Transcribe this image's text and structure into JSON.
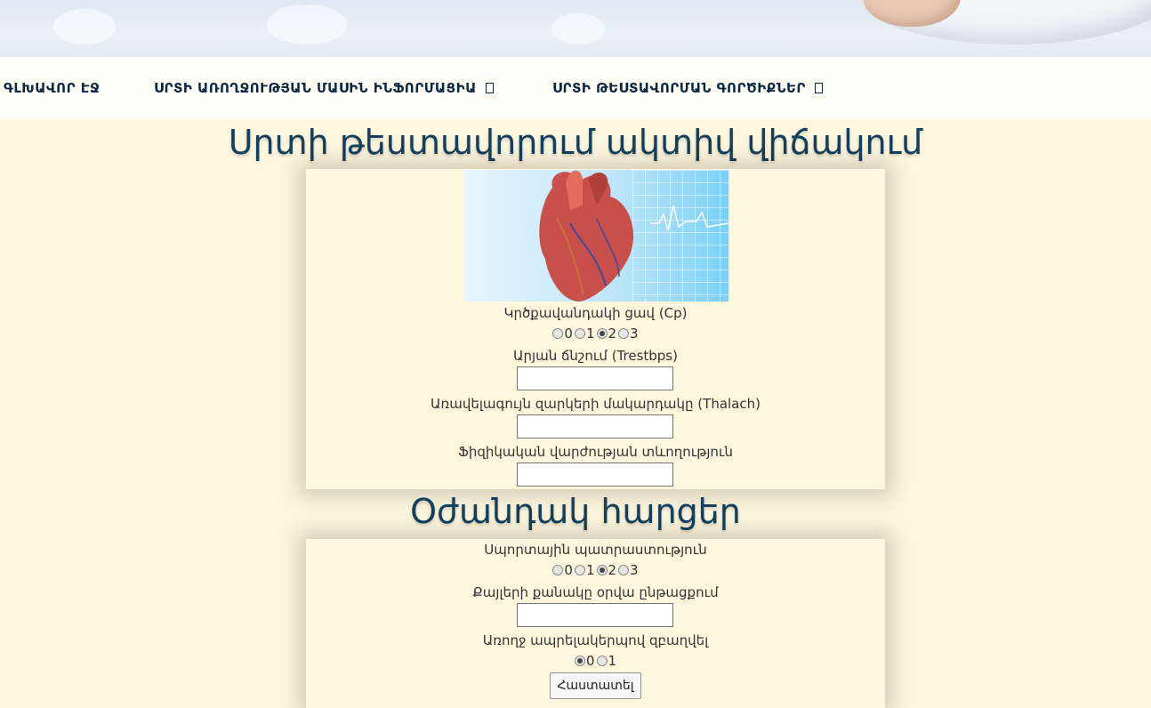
{
  "nav": {
    "items": [
      {
        "label": "ԳԼԽԱՎՈՐ ԷՋ",
        "has_dropdown": false
      },
      {
        "label": "ՍՐՏԻ ԱՌՈՂՋՈՒԹՅԱՆ ՄԱՍԻՆ ԻՆՖՈՐՄԱՑԻԱ",
        "has_dropdown": true
      },
      {
        "label": "ՍՐՏԻ ԹԵՍՏԱՎՈՐՄԱՆ ԳՈՐԾԻՔՆԵՐ",
        "has_dropdown": true
      }
    ]
  },
  "main": {
    "title": "Սրտի թեստավորում ակտիվ վիճակում",
    "fields": {
      "cp": {
        "label": "Կրծքավանդակի ցավ (Cp)",
        "options": [
          "0",
          "1",
          "2",
          "3"
        ],
        "selected": "2"
      },
      "trestbps": {
        "label": "Արյան ճնշում (Trestbps)",
        "value": ""
      },
      "thalach": {
        "label": "Առավելագույն զարկերի մակարդակը (Thalach)",
        "value": ""
      },
      "exercise": {
        "label": "Ֆիզիկական վարժության տևողություն",
        "value": ""
      }
    }
  },
  "extra": {
    "title": "Օժանդակ հարցեր",
    "fields": {
      "sport": {
        "label": "Սպորտային պատրաստություն",
        "options": [
          "0",
          "1",
          "2",
          "3"
        ],
        "selected": "2"
      },
      "steps": {
        "label": "Քայլերի քանակը օրվա ընթացքում",
        "value": ""
      },
      "healthy": {
        "label": "Առողջ ապրելակերպով զբաղվել",
        "options": [
          "0",
          "1"
        ],
        "selected": "0"
      }
    },
    "submit_label": "Հաստատել"
  },
  "colors": {
    "background": "#fff7dd",
    "nav_text": "#0c2740",
    "title": "#12405e"
  }
}
